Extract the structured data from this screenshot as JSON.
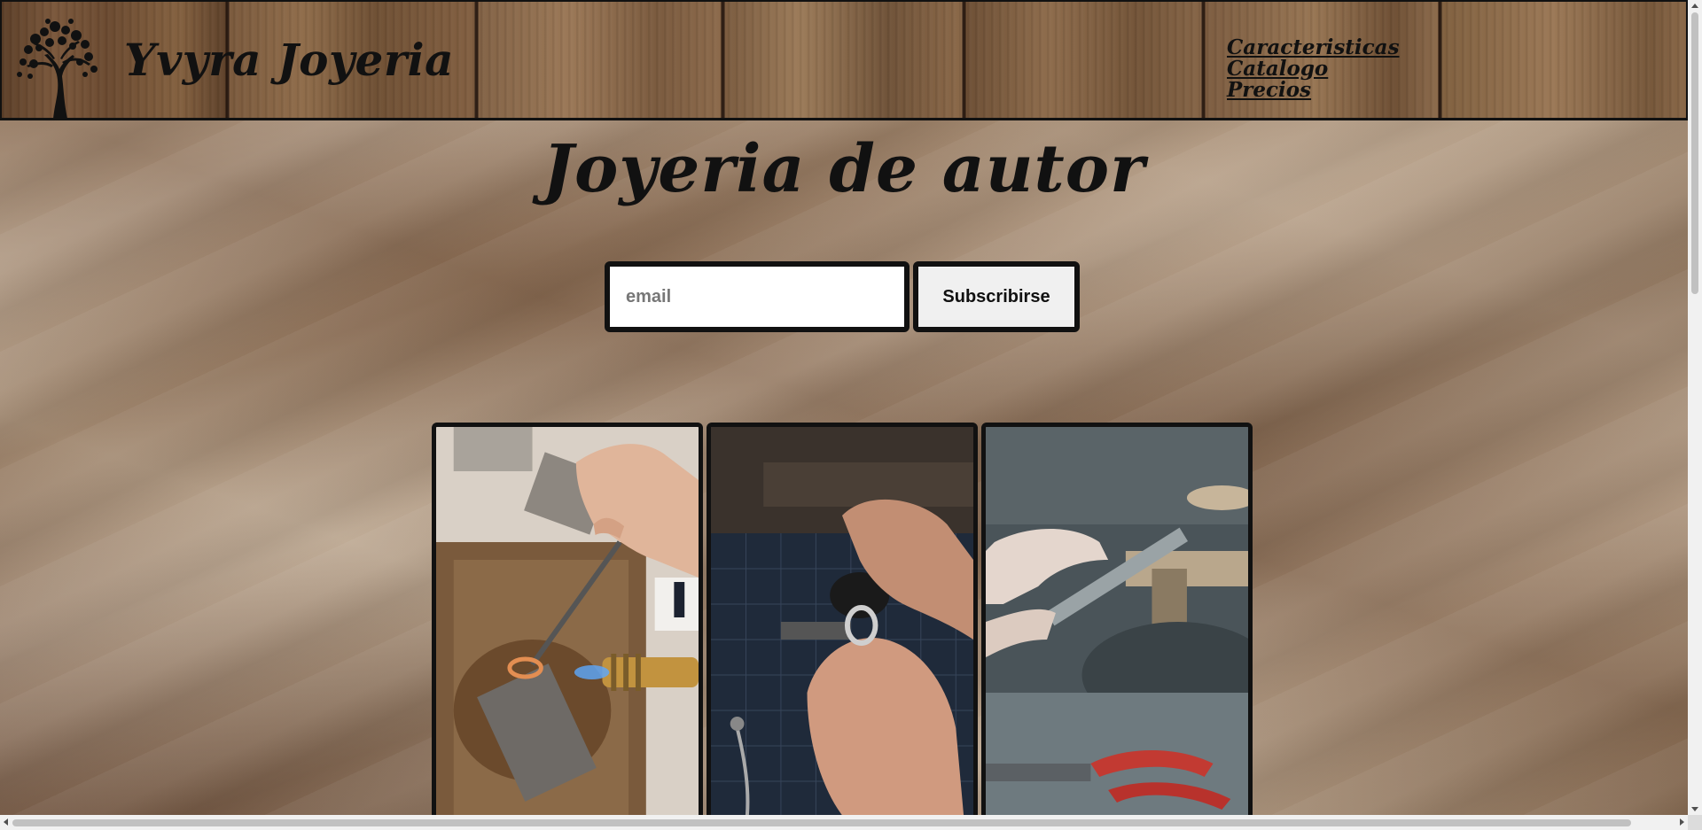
{
  "header": {
    "brand": "Yvyra Joyeria",
    "nav": [
      "Caracteristicas",
      "Catalogo",
      "Precios"
    ]
  },
  "hero": {
    "title": "Joyeria de autor"
  },
  "subscribe": {
    "email_placeholder": "email",
    "email_value": "",
    "button_label": "Subscribirse"
  },
  "gallery": {
    "images": [
      "jeweler-soldering-ring-photo",
      "jeweler-polishing-ring-photo",
      "jeweler-filing-metal-photo"
    ]
  },
  "colors": {
    "text": "#111111",
    "border": "#111111",
    "button_bg": "#f0f0f0",
    "header_wood": "#7a573b",
    "background_wood": "#a68b72"
  }
}
